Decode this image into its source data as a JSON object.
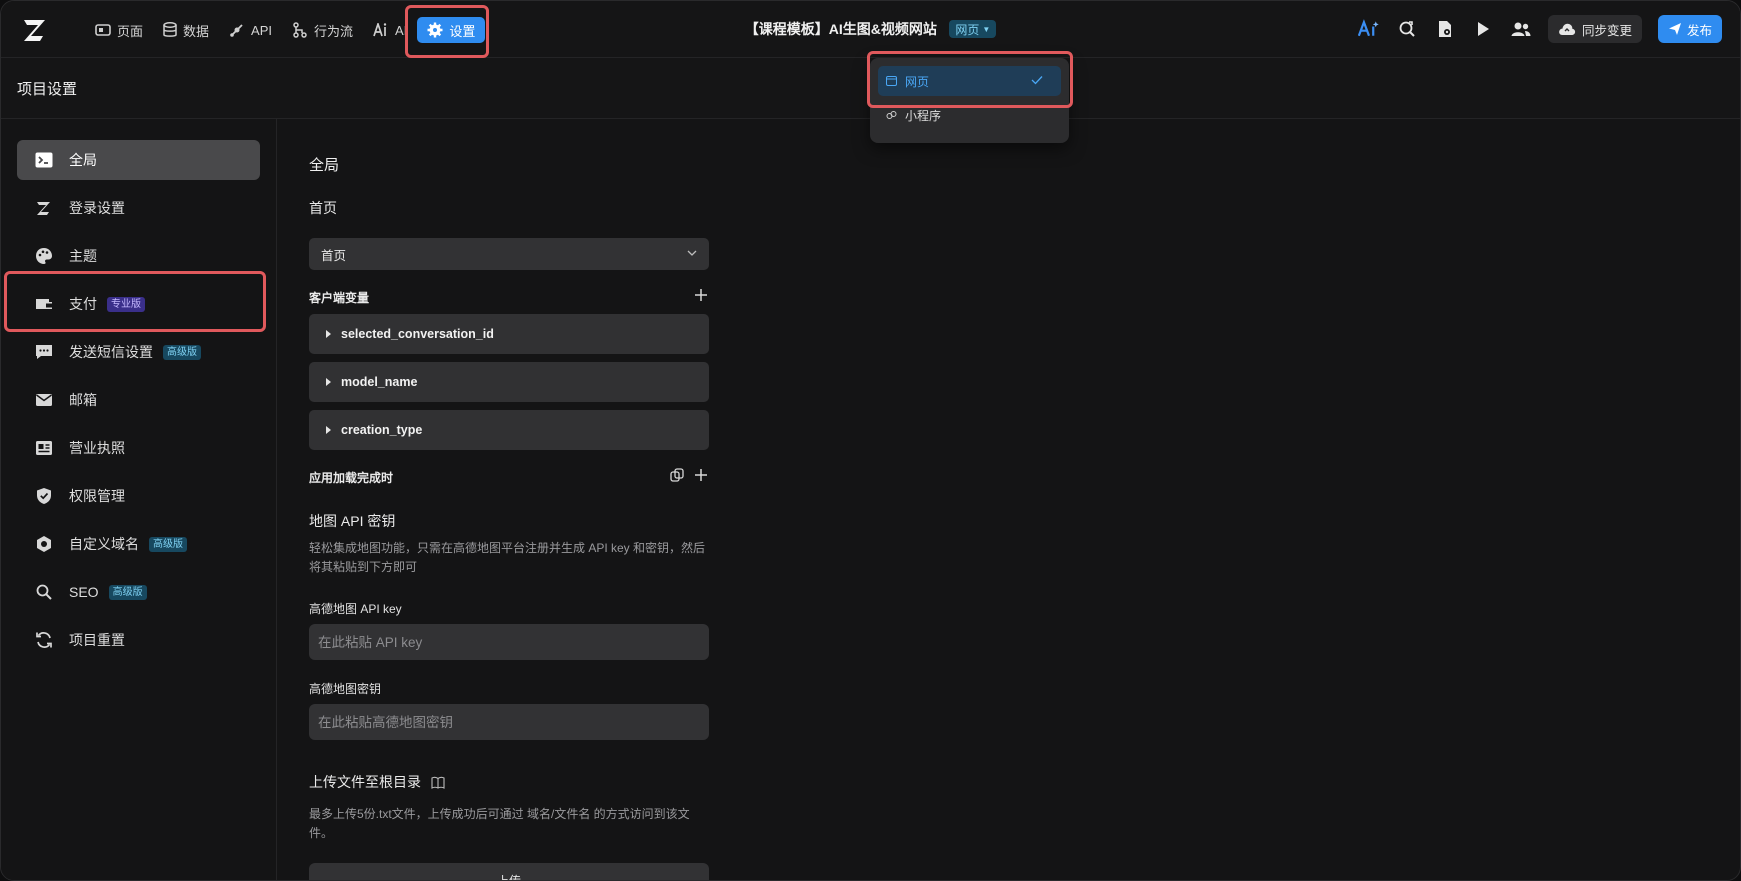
{
  "topbar": {
    "nav": [
      {
        "label": "页面",
        "icon": "pages-icon"
      },
      {
        "label": "数据",
        "icon": "database-icon"
      },
      {
        "label": "API",
        "icon": "api-icon"
      },
      {
        "label": "行为流",
        "icon": "flow-icon"
      },
      {
        "label": "AI",
        "icon": "ai-icon"
      },
      {
        "label": "设置",
        "icon": "gear-icon"
      }
    ],
    "project_title": "【课程模板】AI生图&视频网站",
    "platform_badge": "网页",
    "sync_label": "同步变更",
    "publish_label": "发布",
    "accent": "#2f8cf0"
  },
  "platform_dropdown": {
    "options": [
      {
        "label": "网页",
        "selected": true,
        "icon": "web-icon"
      },
      {
        "label": "小程序",
        "selected": false,
        "icon": "miniprogram-icon"
      }
    ]
  },
  "header": {
    "title": "项目设置"
  },
  "sidebar": {
    "items": [
      {
        "label": "全局",
        "icon": "terminal-icon",
        "active": true,
        "tag": ""
      },
      {
        "label": "登录设置",
        "icon": "login-icon",
        "active": false,
        "tag": ""
      },
      {
        "label": "主题",
        "icon": "palette-icon",
        "active": false,
        "tag": ""
      },
      {
        "label": "支付",
        "icon": "wallet-icon",
        "active": false,
        "tag": "专业版"
      },
      {
        "label": "发送短信设置",
        "icon": "sms-icon",
        "active": false,
        "tag": "高级版"
      },
      {
        "label": "邮箱",
        "icon": "mail-icon",
        "active": false,
        "tag": ""
      },
      {
        "label": "营业执照",
        "icon": "license-icon",
        "active": false,
        "tag": ""
      },
      {
        "label": "权限管理",
        "icon": "shield-icon",
        "active": false,
        "tag": ""
      },
      {
        "label": "自定义域名",
        "icon": "domain-icon",
        "active": false,
        "tag": "高级版"
      },
      {
        "label": "SEO",
        "icon": "search-icon",
        "active": false,
        "tag": "高级版"
      },
      {
        "label": "项目重置",
        "icon": "reset-icon",
        "active": false,
        "tag": ""
      }
    ]
  },
  "main": {
    "section_title": "全局",
    "homepage_label": "首页",
    "homepage_value": "首页",
    "client_vars_label": "客户端变量",
    "client_vars": [
      "selected_conversation_id",
      "model_name",
      "creation_type"
    ],
    "on_load_label": "应用加载完成时",
    "map_title": "地图 API 密钥",
    "map_desc": "轻松集成地图功能，只需在高德地图平台注册并生成 API key 和密钥，然后将其粘贴到下方即可",
    "api_key_label": "高德地图 API key",
    "api_key_placeholder": "在此粘贴 API key",
    "secret_label": "高德地图密钥",
    "secret_placeholder": "在此粘贴高德地图密钥",
    "upload_title": "上传文件至根目录",
    "upload_desc": "最多上传5份.txt文件，上传成功后可通过 域名/文件名 的方式访问到该文件。",
    "upload_button": "上传"
  }
}
